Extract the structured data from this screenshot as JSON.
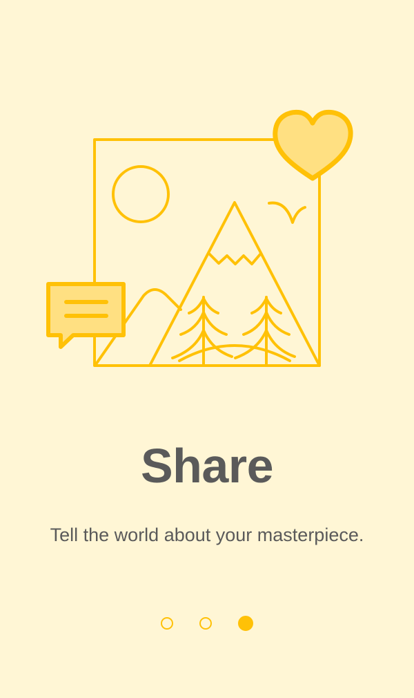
{
  "onboarding": {
    "title": "Share",
    "description": "Tell the world about your masterpiece.",
    "page_indicator": {
      "total": 3,
      "active_index": 2
    }
  },
  "colors": {
    "background": "#fff6d5",
    "accent": "#ffc107",
    "accent_light": "#ffe082",
    "text": "#5a5a5a"
  },
  "icons": {
    "illustration": "photo-share-illustration",
    "heart": "heart-icon",
    "chat": "chat-bubble-icon"
  }
}
